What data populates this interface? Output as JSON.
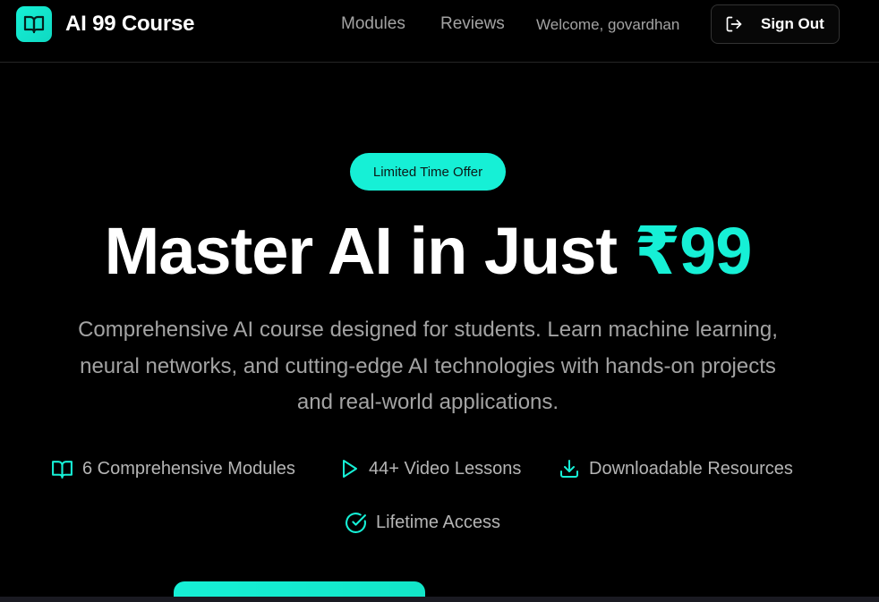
{
  "header": {
    "brand_title": "AI 99 Course",
    "brand_icon": "book-open-icon",
    "nav": {
      "modules": "Modules",
      "reviews": "Reviews"
    },
    "welcome_text": "Welcome, govardhan",
    "signout_label": "Sign Out",
    "signout_icon": "log-out-icon"
  },
  "hero": {
    "badge": "Limited Time Offer",
    "headline_prefix": "Master AI in Just ",
    "headline_price": "₹99",
    "description": "Comprehensive AI course designed for students. Learn machine learning, neural networks, and cutting-edge AI technologies with hands-on projects and real-world applications.",
    "features": [
      {
        "icon": "book-open-icon",
        "label": "6 Comprehensive Modules"
      },
      {
        "icon": "play-icon",
        "label": "44+ Video Lessons"
      },
      {
        "icon": "download-icon",
        "label": "Downloadable Resources"
      },
      {
        "icon": "check-circle-icon",
        "label": "Lifetime Access"
      }
    ]
  },
  "colors": {
    "accent": "#16f0d6",
    "background": "#000000",
    "muted_text": "#a3a3a3"
  }
}
